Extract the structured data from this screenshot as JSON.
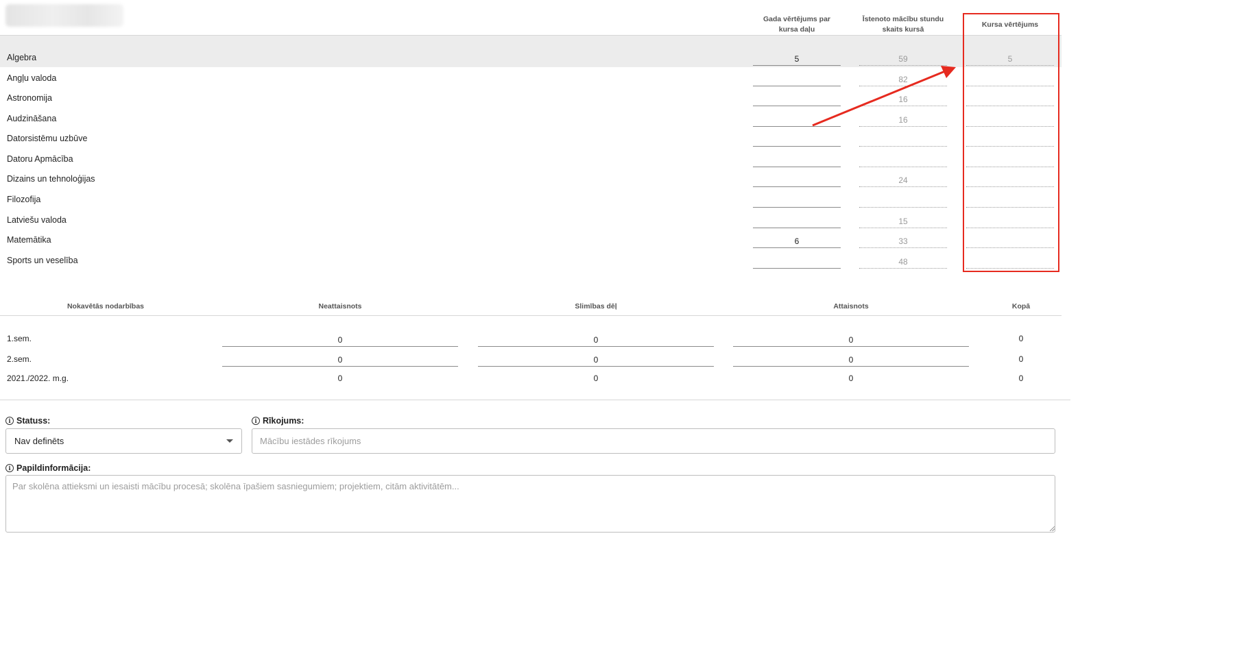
{
  "grades_table": {
    "headers": {
      "annual_grade": "Gada vērtējums par kursa daļu",
      "hours": "Īstenoto mācību stundu skaits kursā",
      "course_grade": "Kursa vērtējums"
    },
    "rows": [
      {
        "subject": "Algebra",
        "annual_grade": "5",
        "hours": "59",
        "course_grade": "5"
      },
      {
        "subject": "Angļu valoda",
        "annual_grade": "",
        "hours": "82",
        "course_grade": ""
      },
      {
        "subject": "Astronomija",
        "annual_grade": "",
        "hours": "16",
        "course_grade": ""
      },
      {
        "subject": "Audzināšana",
        "annual_grade": "",
        "hours": "16",
        "course_grade": ""
      },
      {
        "subject": "Datorsistēmu uzbūve",
        "annual_grade": "",
        "hours": "",
        "course_grade": ""
      },
      {
        "subject": "Datoru Apmācība",
        "annual_grade": "",
        "hours": "",
        "course_grade": ""
      },
      {
        "subject": "Dizains un tehnoloģijas",
        "annual_grade": "",
        "hours": "24",
        "course_grade": ""
      },
      {
        "subject": "Filozofija",
        "annual_grade": "",
        "hours": "",
        "course_grade": ""
      },
      {
        "subject": "Latviešu valoda",
        "annual_grade": "",
        "hours": "15",
        "course_grade": ""
      },
      {
        "subject": "Matemātika",
        "annual_grade": "6",
        "hours": "33",
        "course_grade": ""
      },
      {
        "subject": "Sports un veselība",
        "annual_grade": "",
        "hours": "48",
        "course_grade": ""
      }
    ]
  },
  "annotation": {
    "highlight_color": "#e62a1f",
    "arrow_color": "#e62a1f"
  },
  "absences_table": {
    "headers": {
      "label": "Nokavētās nodarbības",
      "unexcused": "Neattaisnots",
      "illness": "Slimības dēļ",
      "excused": "Attaisnots",
      "total": "Kopā"
    },
    "rows": [
      {
        "label": "1.sem.",
        "unexcused": "0",
        "illness": "0",
        "excused": "0",
        "total": "0"
      },
      {
        "label": "2.sem.",
        "unexcused": "0",
        "illness": "0",
        "excused": "0",
        "total": "0"
      },
      {
        "label": "2021./2022. m.g.",
        "unexcused": "0",
        "illness": "0",
        "excused": "0",
        "total": "0"
      }
    ]
  },
  "form": {
    "status": {
      "label": "Statuss:",
      "value": "Nav definēts"
    },
    "order": {
      "label": "Rīkojums:",
      "placeholder": "Mācību iestādes rīkojums"
    },
    "additional": {
      "label": "Papildinformācija:",
      "placeholder": "Par skolēna attieksmi un iesaisti mācību procesā; skolēna īpašiem sasniegumiem; projektiem, citām aktivitātēm..."
    },
    "info_icon": "info-circle-icon"
  }
}
